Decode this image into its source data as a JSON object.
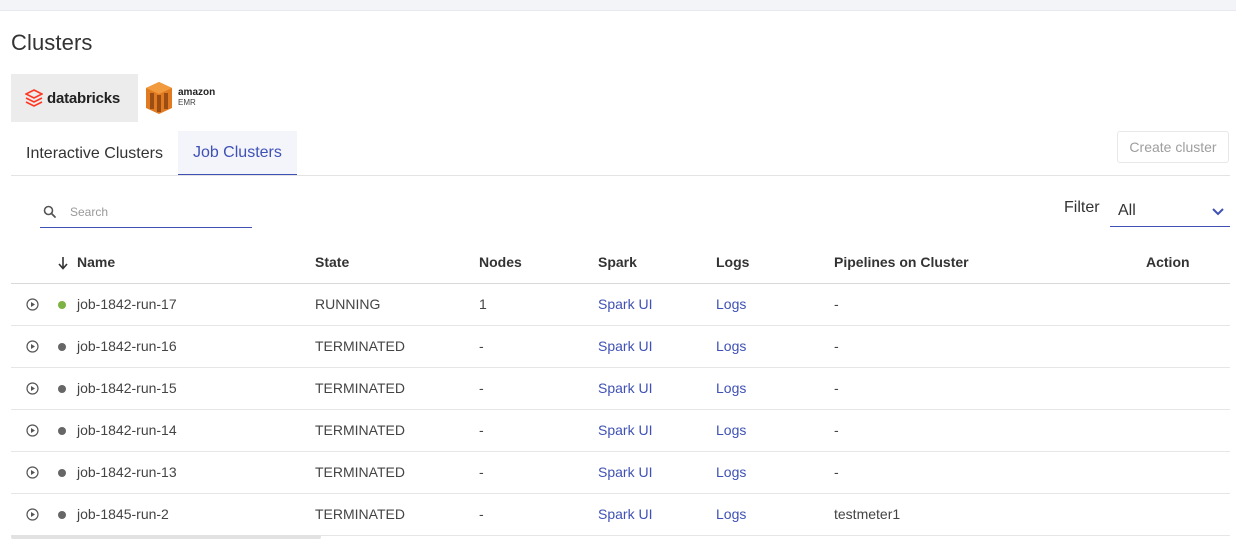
{
  "page": {
    "title": "Clusters"
  },
  "providers": [
    {
      "name": "databricks",
      "label": "databricks",
      "active": true
    },
    {
      "name": "amazon-emr",
      "line1": "amazon",
      "line2": "EMR",
      "active": false
    }
  ],
  "tabs": [
    {
      "label": "Interactive Clusters",
      "active": false
    },
    {
      "label": "Job Clusters",
      "active": true
    }
  ],
  "toolbar": {
    "create_label": "Create cluster"
  },
  "search": {
    "placeholder": "Search",
    "value": ""
  },
  "filter": {
    "label": "Filter",
    "value": "All"
  },
  "colors": {
    "accent": "#3f51b5",
    "running": "#7cb342",
    "terminated": "#666666"
  },
  "table": {
    "headers": {
      "name": "Name",
      "state": "State",
      "nodes": "Nodes",
      "spark": "Spark",
      "logs": "Logs",
      "pipelines": "Pipelines on Cluster",
      "action": "Action"
    },
    "rows": [
      {
        "name": "job-1842-run-17",
        "state": "RUNNING",
        "nodes": "1",
        "spark": "Spark UI",
        "logs": "Logs",
        "pipelines": "-",
        "status_color": "#7cb342"
      },
      {
        "name": "job-1842-run-16",
        "state": "TERMINATED",
        "nodes": "-",
        "spark": "Spark UI",
        "logs": "Logs",
        "pipelines": "-",
        "status_color": "#666666"
      },
      {
        "name": "job-1842-run-15",
        "state": "TERMINATED",
        "nodes": "-",
        "spark": "Spark UI",
        "logs": "Logs",
        "pipelines": "-",
        "status_color": "#666666"
      },
      {
        "name": "job-1842-run-14",
        "state": "TERMINATED",
        "nodes": "-",
        "spark": "Spark UI",
        "logs": "Logs",
        "pipelines": "-",
        "status_color": "#666666"
      },
      {
        "name": "job-1842-run-13",
        "state": "TERMINATED",
        "nodes": "-",
        "spark": "Spark UI",
        "logs": "Logs",
        "pipelines": "-",
        "status_color": "#666666"
      },
      {
        "name": "job-1845-run-2",
        "state": "TERMINATED",
        "nodes": "-",
        "spark": "Spark UI",
        "logs": "Logs",
        "pipelines": "testmeter1",
        "status_color": "#666666"
      }
    ]
  }
}
